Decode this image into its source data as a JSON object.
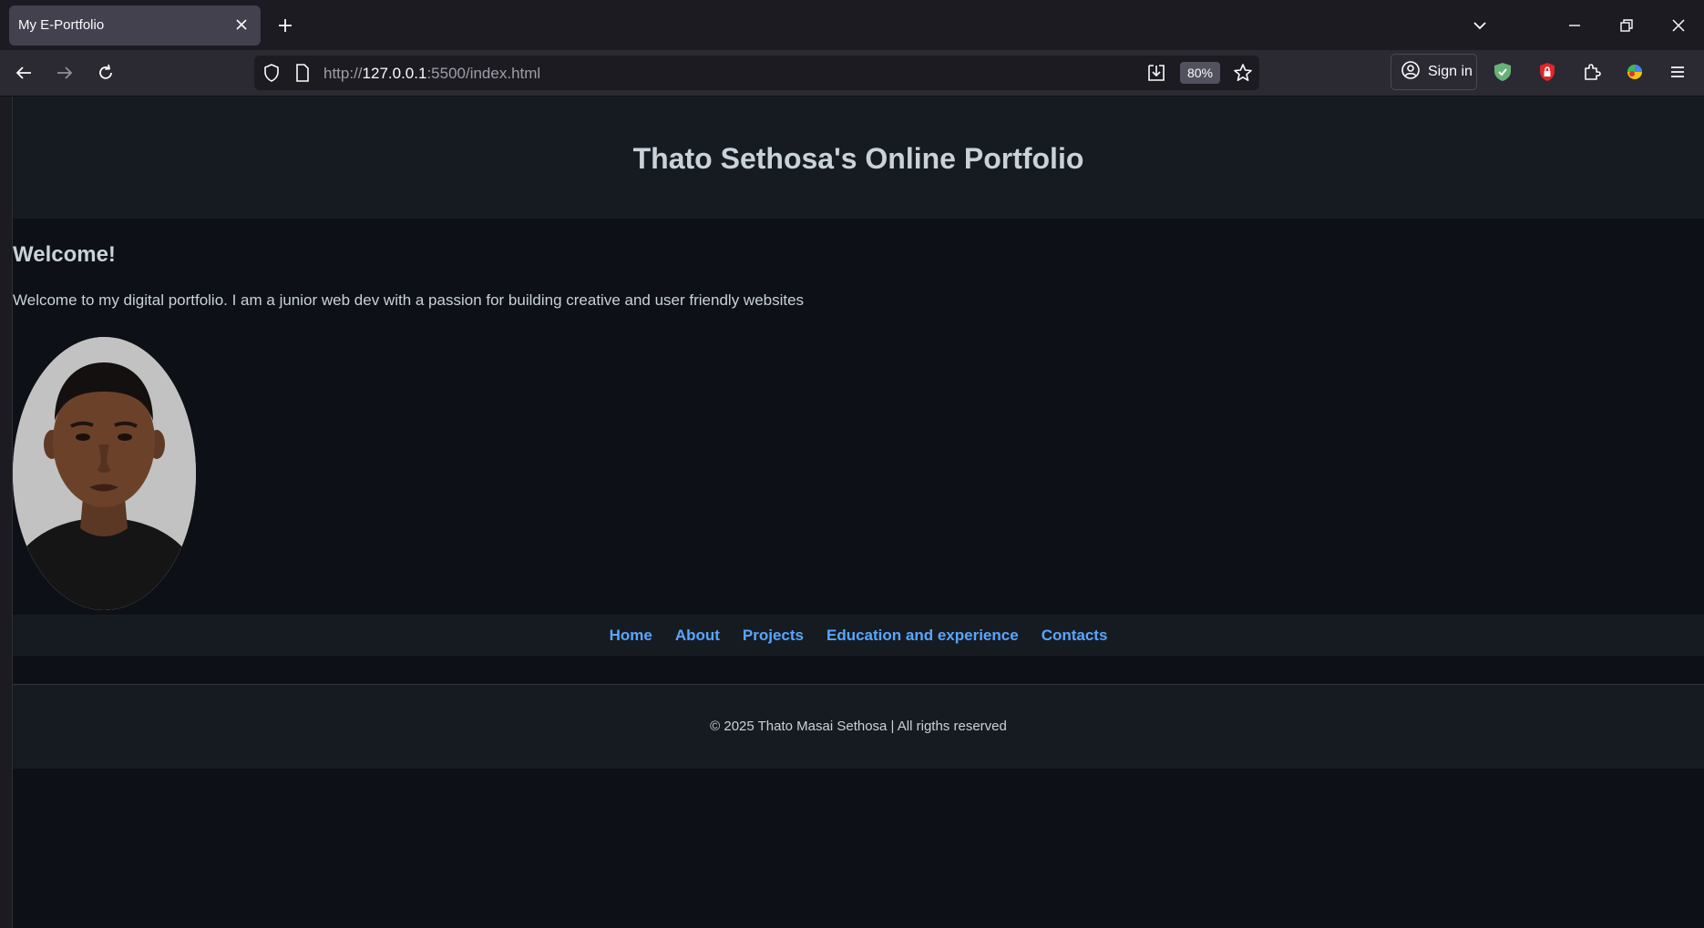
{
  "browser": {
    "tab_title": "My E-Portfolio",
    "url_scheme": "http://",
    "url_host": "127.0.0.1",
    "url_rest": ":5500/index.html",
    "zoom": "80%",
    "sign_in_label": "Sign in"
  },
  "page": {
    "site_title": "Thato Sethosa's Online Portfolio",
    "welcome_heading": "Welcome!",
    "welcome_text": "Welcome to my digital portfolio. I am a junior web dev with a passion for building creative and user friendly websites",
    "nav": [
      "Home",
      "About",
      "Projects",
      "Education and experience",
      "Contacts"
    ],
    "footer": "© 2025 Thato Masai Sethosa | All rigths reserved"
  },
  "colors": {
    "page_bg": "#0d1017",
    "header_bg": "#161b22",
    "text": "#c9d1d9",
    "link": "#58a6ff"
  },
  "icons": [
    "new-tab-icon",
    "tab-list-icon",
    "minimize-icon",
    "restore-icon",
    "window-close-icon",
    "back-icon",
    "forward-icon",
    "reload-icon",
    "shield-icon",
    "page-icon",
    "download-page-icon",
    "star-icon",
    "account-icon",
    "adguard-icon",
    "lock-extension-icon",
    "extensions-icon",
    "colorful-extension-icon",
    "menu-icon"
  ]
}
